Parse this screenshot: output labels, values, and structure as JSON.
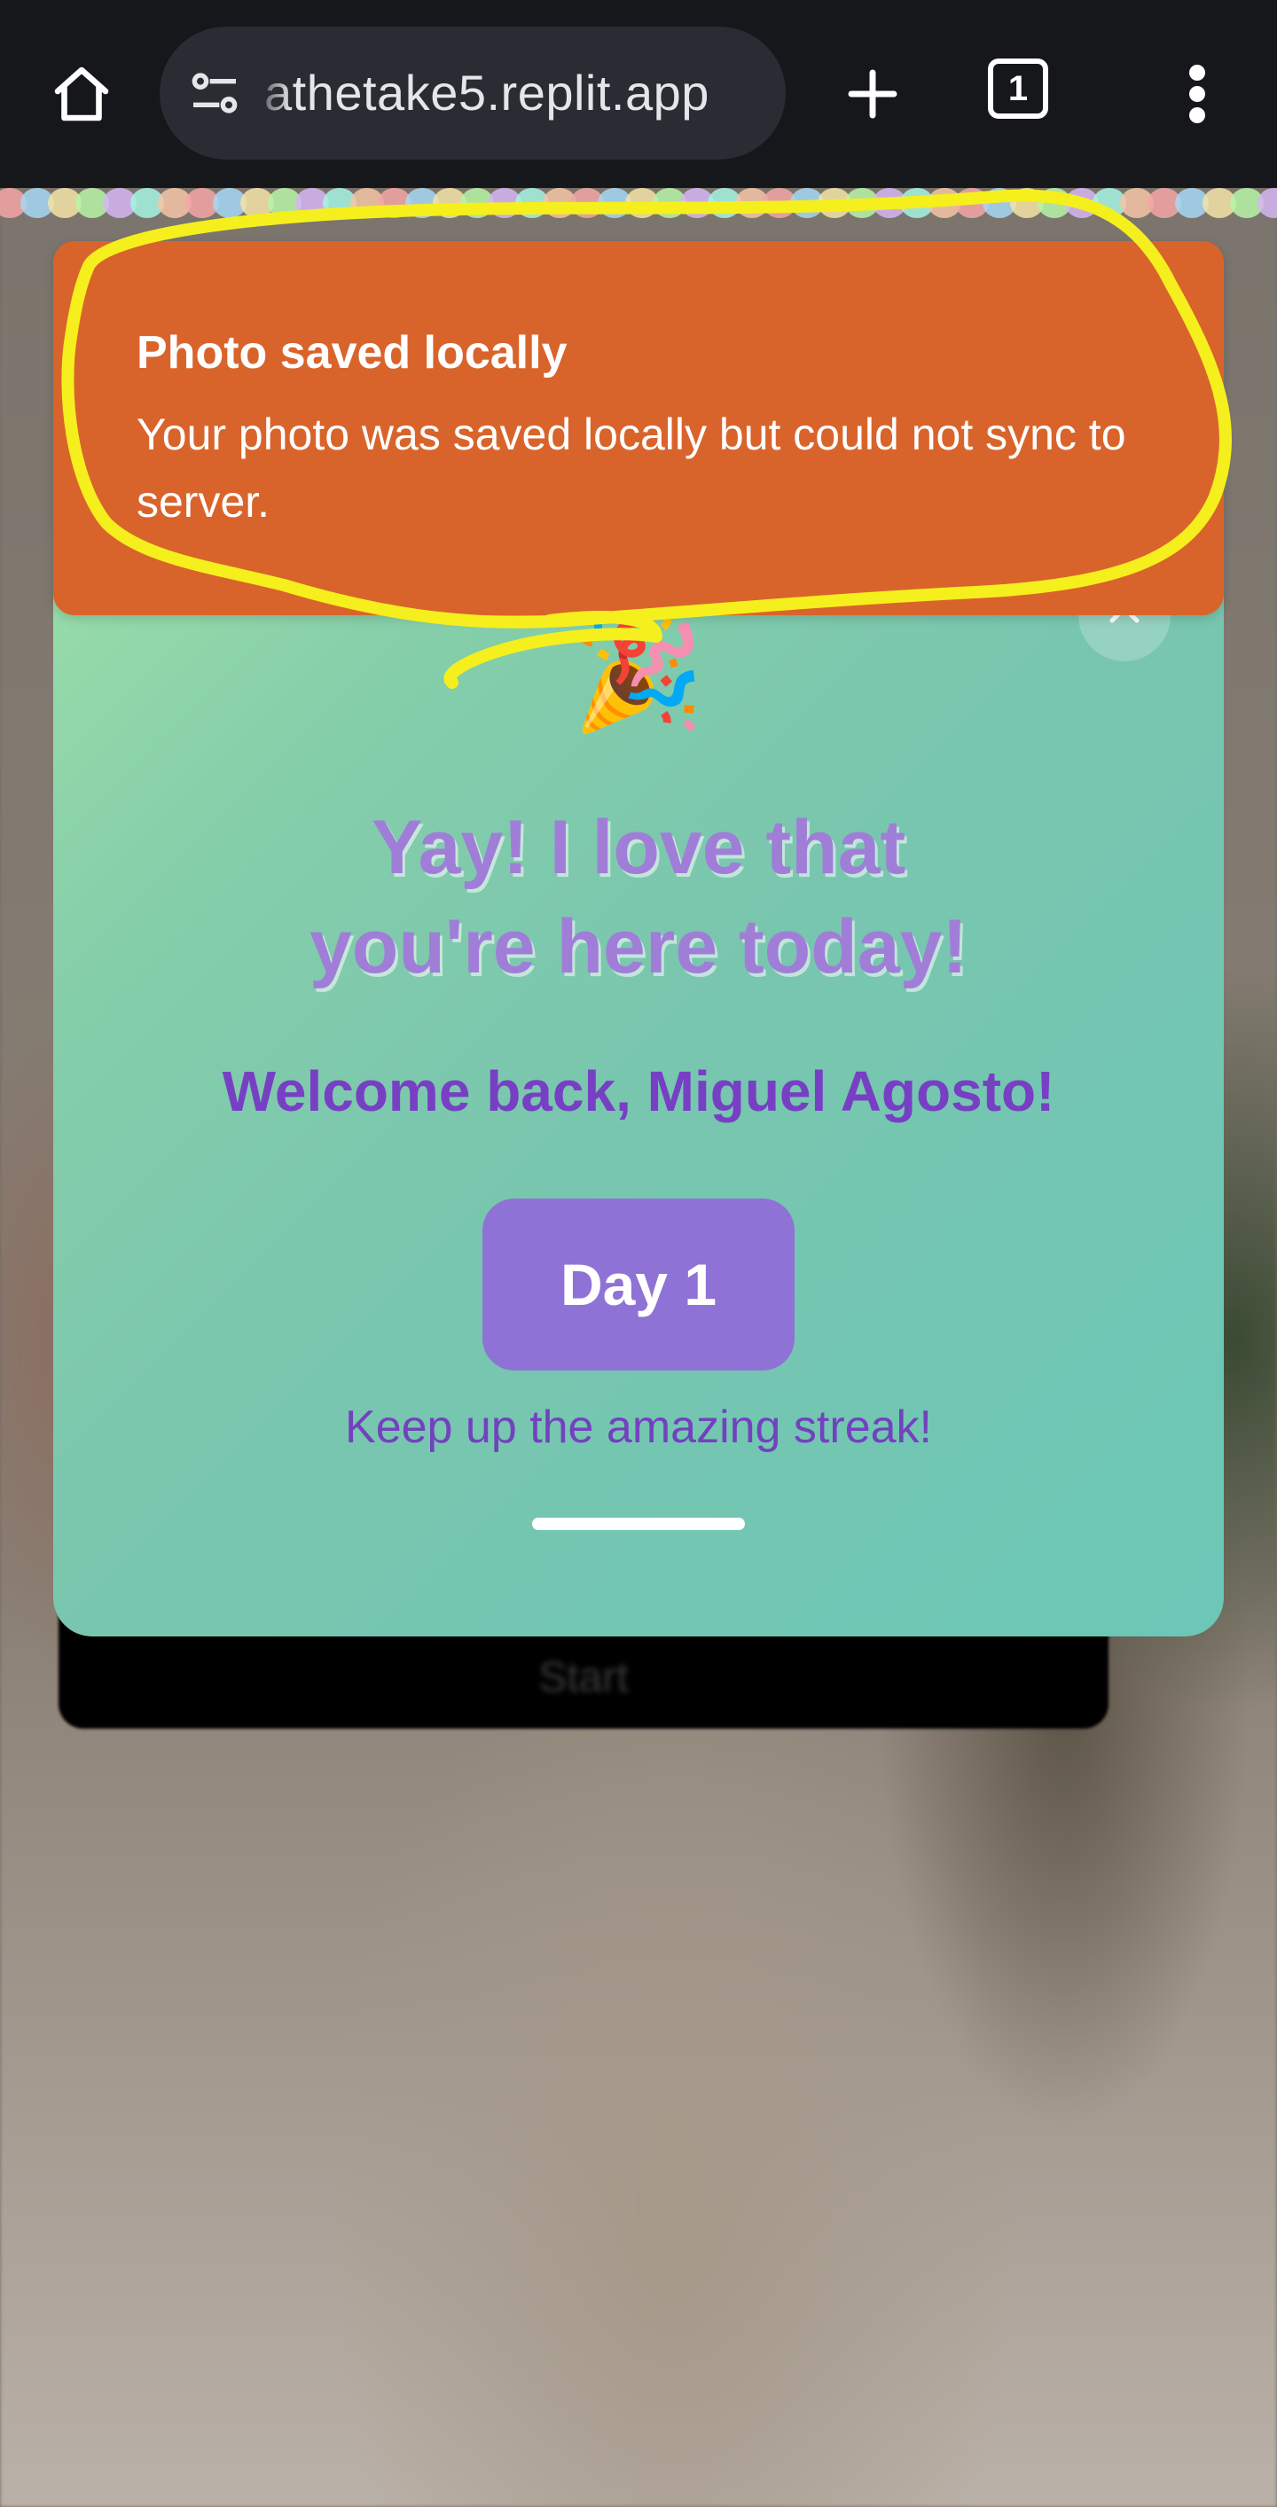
{
  "browser": {
    "url_text": "athetake5.replit.app",
    "tab_count": "1"
  },
  "background": {
    "start_button_label": "Start"
  },
  "toast": {
    "title": "Photo saved locally",
    "message": "Your photo was saved locally but could not sync to server.",
    "color": "#d9642b"
  },
  "modal": {
    "emoji": "🎉",
    "headline_line1": "Yay! I love that",
    "headline_line2": "you're here today!",
    "welcome": "Welcome back, Miguel Agosto!",
    "day_badge": "Day 1",
    "streak_message": "Keep up the amazing streak!",
    "accent_color": "#8f72d6"
  },
  "annotation": {
    "color": "#f5ef1e"
  }
}
